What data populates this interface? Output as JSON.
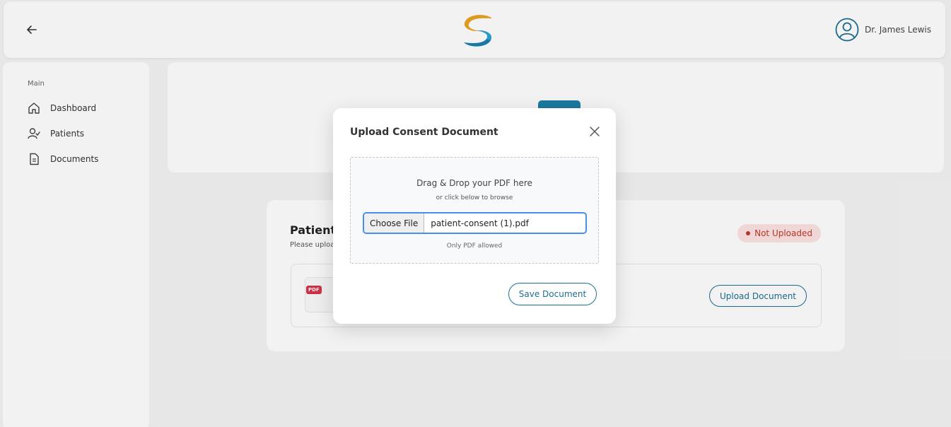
{
  "header": {
    "user_name": "Dr. James Lewis"
  },
  "sidebar": {
    "section_label": "Main",
    "items": [
      {
        "label": "Dashboard",
        "icon": "home-icon"
      },
      {
        "label": "Patients",
        "icon": "user-check-icon"
      },
      {
        "label": "Documents",
        "icon": "document-icon"
      }
    ]
  },
  "patient_card": {
    "title": "Patient",
    "subtitle": "Please uploa",
    "status": "Not Uploaded",
    "file_type_tag": "PDF",
    "upload_label": "Upload Document"
  },
  "modal": {
    "title": "Upload Consent Document",
    "drop_text": "Drag & Drop your PDF here",
    "browse_text": "or click below to browse",
    "choose_file_label": "Choose File",
    "selected_file": "patient-consent (1).pdf",
    "note": "Only PDF allowed",
    "save_label": "Save Document"
  },
  "colors": {
    "primary": "#1d6f92",
    "status_red": "#c0392b",
    "focus_blue": "#4a8fe7"
  }
}
